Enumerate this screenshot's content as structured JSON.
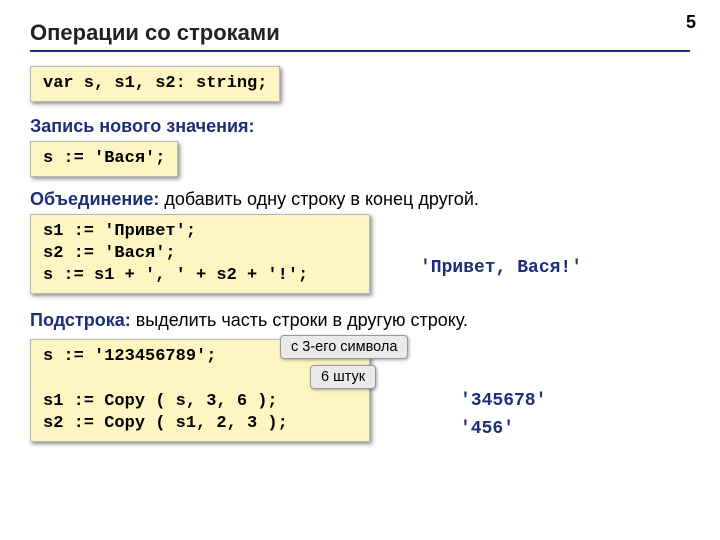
{
  "page_number": "5",
  "title": "Операции со строками",
  "code1": "var s, s1, s2: string;",
  "section1": {
    "label": "Запись нового значения:"
  },
  "code2": "s := 'Вася';",
  "section2": {
    "label": "Объединение:",
    "text": " добавить одну строку в конец другой."
  },
  "code3": "s1 := 'Привет';\ns2 := 'Вася';\ns := s1 + ', ' + s2 + '!';",
  "result1": "'Привет, Вася!'",
  "section3": {
    "label": "Подстрока:",
    "text": " выделить часть строки в другую строку."
  },
  "code4": "s := '123456789';\n\ns1 := Copy ( s, 3, 6 );\ns2 := Copy ( s1, 2, 3 );",
  "callout1": "с 3-его символа",
  "callout2": "6 штук",
  "result2": "'345678'",
  "result3": "'456'"
}
